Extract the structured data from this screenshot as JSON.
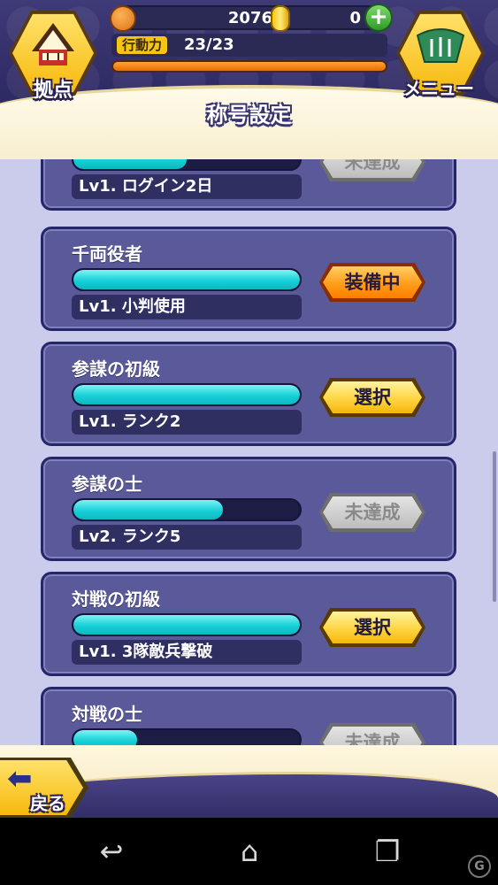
{
  "header": {
    "home_label": "拠点",
    "menu_label": "メニュー",
    "coins": "2076",
    "gold": "0",
    "plus_label": "+",
    "stamina_label": "行動力",
    "stamina_value": "23/23",
    "stamina_fraction": 1.0,
    "title": "称号設定"
  },
  "titles": [
    {
      "name": "",
      "requirement": "Lv1. ログイン2日",
      "progress": 0.5,
      "action": "未達成",
      "state": "locked"
    },
    {
      "name": "千両役者",
      "requirement": "Lv1. 小判使用",
      "progress": 1.0,
      "action": "装備中",
      "state": "equipped"
    },
    {
      "name": "参謀の初級",
      "requirement": "Lv1. ランク2",
      "progress": 1.0,
      "action": "選択",
      "state": "select"
    },
    {
      "name": "参謀の士",
      "requirement": "Lv2. ランク5",
      "progress": 0.66,
      "action": "未達成",
      "state": "locked"
    },
    {
      "name": "対戦の初級",
      "requirement": "Lv1. 3隊敵兵撃破",
      "progress": 1.0,
      "action": "選択",
      "state": "select"
    },
    {
      "name": "対戦の士",
      "requirement": "",
      "progress": 0.28,
      "action": "未達成",
      "state": "locked"
    }
  ],
  "footer": {
    "back_label": "戻る"
  },
  "navbar": {
    "back_icon": "↩",
    "home_icon": "⌂",
    "recent_icon": "❐",
    "watermark": "G"
  },
  "colors": {
    "card_bg": "#5a5a9a",
    "progress": "#16d0d8",
    "select_button": "#ffd84a",
    "equipped_button": "#ff9d1a",
    "locked_button": "#bdbdbd"
  }
}
